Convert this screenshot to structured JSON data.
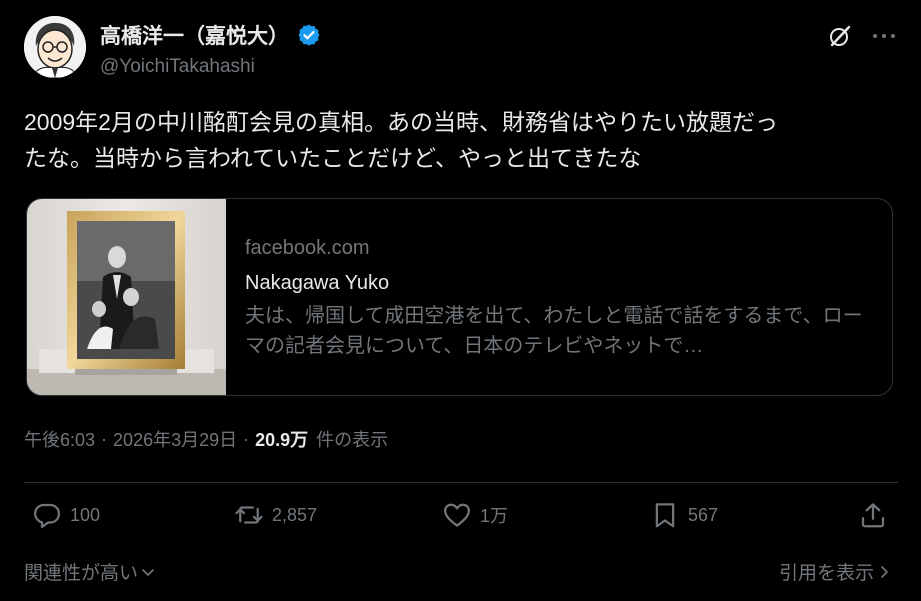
{
  "author": {
    "display_name": "高橋洋一（嘉悦大）",
    "handle": "@YoichiTakahashi",
    "verified": true
  },
  "tweet": {
    "lines": [
      "2009年2月の中川酩酊会見の真相。あの当時、財務省はやりたい放題だっ",
      "たな。当時から言われていたことだけど、やっと出てきたな"
    ]
  },
  "card": {
    "domain": "facebook.com",
    "title": "Nakagawa Yuko",
    "description": "夫は、帰国して成田空港を出て、わたしと電話で話をするまで、ローマの記者会見について、日本のテレビやネットで…"
  },
  "meta": {
    "time": "午後6:03",
    "separator": "·",
    "date": "2026年3月29日",
    "views": "20.9万",
    "views_label": "件の表示"
  },
  "actions": {
    "reply_count": "100",
    "retweet_count": "2,857",
    "like_count": "1万",
    "bookmark_count": "567"
  },
  "footer": {
    "sort_label": "関連性が高い",
    "quotes_label": "引用を表示"
  },
  "colors": {
    "background": "#000000",
    "text": "#e7e9ea",
    "muted": "#71767b",
    "border": "#2f3336",
    "verified": "#1d9bf0"
  },
  "icons": [
    "grok-icon",
    "more-icon",
    "reply-icon",
    "retweet-icon",
    "like-icon",
    "bookmark-icon",
    "share-icon",
    "chevron-down-icon",
    "chevron-right-icon",
    "verified-badge-icon"
  ]
}
